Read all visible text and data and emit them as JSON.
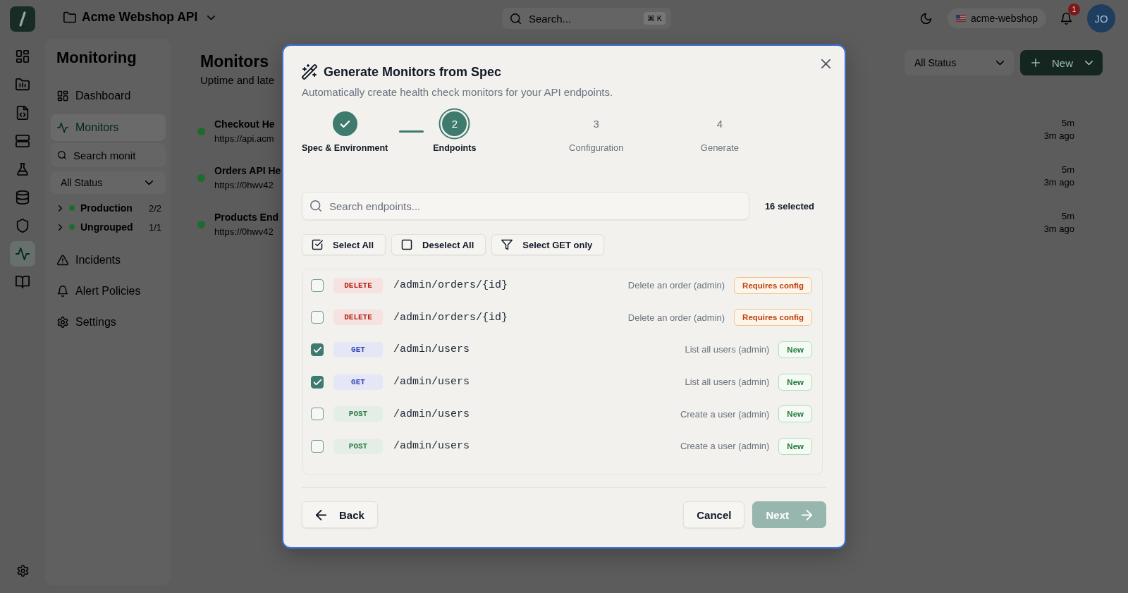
{
  "topbar": {
    "project": "Acme Webshop API",
    "search": {
      "placeholder": "Search...",
      "shortcut": "⌘ K"
    },
    "workspace": "acme-webshop",
    "notifications": "1",
    "avatar": "JO"
  },
  "rail": {
    "items": [
      {
        "kind": "grid",
        "selected": false
      },
      {
        "kind": "folder-chart",
        "selected": false
      },
      {
        "kind": "file-code",
        "selected": false
      },
      {
        "kind": "server",
        "selected": false
      },
      {
        "kind": "flask",
        "selected": false
      },
      {
        "kind": "database",
        "selected": false
      },
      {
        "kind": "shield",
        "selected": false
      },
      {
        "kind": "pulse",
        "selected": true
      },
      {
        "kind": "book",
        "selected": false
      }
    ]
  },
  "sidebar": {
    "title": "Monitoring",
    "items": [
      {
        "kind": "grid",
        "label": "Dashboard",
        "selected": false
      },
      {
        "kind": "pulse",
        "label": "Monitors",
        "selected": true
      }
    ],
    "search": {
      "placeholder": "Search monit"
    },
    "filter": "All Status",
    "groups": [
      {
        "label": "Production",
        "count": "2/2",
        "color": "#1e6b2f",
        "expanded": false
      },
      {
        "label": "Ungrouped",
        "count": "1/1",
        "color": "#1e6b2f",
        "expanded": false
      }
    ],
    "links": [
      {
        "kind": "alert",
        "label": "Incidents",
        "selected": false
      },
      {
        "kind": "bell",
        "label": "Alert Policies",
        "selected": false
      },
      {
        "kind": "gear",
        "label": "Settings",
        "selected": false
      }
    ]
  },
  "main": {
    "title": "Monitors",
    "subtitle": "Uptime and late",
    "filter": "All Status",
    "new_button": "New",
    "monitors": [
      {
        "name": "Checkout He",
        "url": "https://api.acm",
        "color": "#1e6b2f",
        "interval": "5m",
        "last_check": "3m ago"
      },
      {
        "name": "Orders API He",
        "url": "https://0hwv42",
        "color": "#1e6b2f",
        "interval": "5m",
        "last_check": "3m ago"
      },
      {
        "name": "Products End",
        "url": "https://0hwv42",
        "color": "#1e6b2f",
        "interval": "5m",
        "last_check": "3m ago"
      }
    ]
  },
  "modal": {
    "title": "Generate Monitors from Spec",
    "subtitle": "Automatically create health check monitors for your API endpoints.",
    "steps": [
      {
        "label": "Spec & Environment",
        "completed": true,
        "selected": false
      },
      {
        "number": "2",
        "label": "Endpoints",
        "completed": false,
        "selected": true
      },
      {
        "number": "3",
        "label": "Configuration",
        "completed": false,
        "selected": false
      },
      {
        "number": "4",
        "label": "Generate",
        "completed": false,
        "selected": false
      }
    ],
    "search": {
      "placeholder": "Search endpoints..."
    },
    "selected_count": "16 selected",
    "actions": [
      {
        "kind": "check-all",
        "label": "Select All"
      },
      {
        "kind": "clear",
        "label": "Deselect All"
      },
      {
        "kind": "filter",
        "label": "Select GET only"
      }
    ],
    "endpoints": [
      {
        "checked": false,
        "method": {
          "label": "DELETE",
          "color": "#b42318"
        },
        "path": "/admin/orders/{id}",
        "description": "Delete an order (admin)",
        "status": {
          "kind": "warning",
          "label": "Requires config"
        }
      },
      {
        "checked": false,
        "method": {
          "label": "DELETE",
          "color": "#b42318"
        },
        "path": "/admin/orders/{id}",
        "description": "Delete an order (admin)",
        "status": {
          "kind": "warning",
          "label": "Requires config"
        }
      },
      {
        "checked": true,
        "method": {
          "label": "GET",
          "color": "#3446b8"
        },
        "path": "/admin/users",
        "description": "List all users (admin)",
        "status": {
          "kind": "new",
          "label": "New"
        }
      },
      {
        "checked": true,
        "method": {
          "label": "GET",
          "color": "#3446b8"
        },
        "path": "/admin/users",
        "description": "List all users (admin)",
        "status": {
          "kind": "new",
          "label": "New"
        }
      },
      {
        "checked": false,
        "method": {
          "label": "POST",
          "color": "#2e7a43"
        },
        "path": "/admin/users",
        "description": "Create a user (admin)",
        "status": {
          "kind": "new",
          "label": "New"
        }
      },
      {
        "checked": false,
        "method": {
          "label": "POST",
          "color": "#2e7a43"
        },
        "path": "/admin/users",
        "description": "Create a user (admin)",
        "status": {
          "kind": "new",
          "label": "New"
        }
      }
    ],
    "back": "Back",
    "cancel": "Cancel",
    "next": {
      "label": "Next",
      "disabled": true
    }
  }
}
